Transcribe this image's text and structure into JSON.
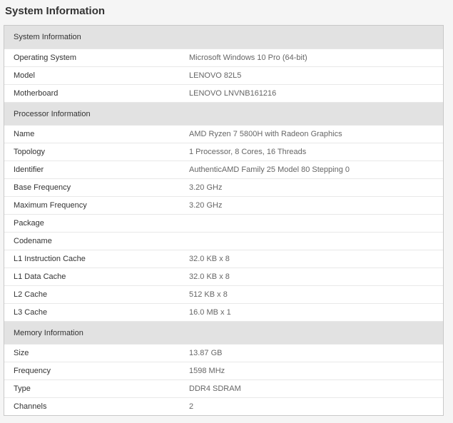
{
  "page_title": "System Information",
  "sections": [
    {
      "title": "System Information",
      "rows": [
        {
          "label": "Operating System",
          "value": "Microsoft Windows 10 Pro (64-bit)"
        },
        {
          "label": "Model",
          "value": "LENOVO 82L5"
        },
        {
          "label": "Motherboard",
          "value": "LENOVO LNVNB161216"
        }
      ]
    },
    {
      "title": "Processor Information",
      "rows": [
        {
          "label": "Name",
          "value": "AMD Ryzen 7 5800H with Radeon Graphics"
        },
        {
          "label": "Topology",
          "value": "1 Processor, 8 Cores, 16 Threads"
        },
        {
          "label": "Identifier",
          "value": "AuthenticAMD Family 25 Model 80 Stepping 0"
        },
        {
          "label": "Base Frequency",
          "value": "3.20 GHz"
        },
        {
          "label": "Maximum Frequency",
          "value": "3.20 GHz"
        },
        {
          "label": "Package",
          "value": ""
        },
        {
          "label": "Codename",
          "value": ""
        },
        {
          "label": "L1 Instruction Cache",
          "value": "32.0 KB x 8"
        },
        {
          "label": "L1 Data Cache",
          "value": "32.0 KB x 8"
        },
        {
          "label": "L2 Cache",
          "value": "512 KB x 8"
        },
        {
          "label": "L3 Cache",
          "value": "16.0 MB x 1"
        }
      ]
    },
    {
      "title": "Memory Information",
      "rows": [
        {
          "label": "Size",
          "value": "13.87 GB"
        },
        {
          "label": "Frequency",
          "value": "1598 MHz"
        },
        {
          "label": "Type",
          "value": "DDR4 SDRAM"
        },
        {
          "label": "Channels",
          "value": "2"
        }
      ]
    }
  ]
}
